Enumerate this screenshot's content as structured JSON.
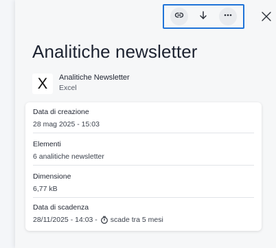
{
  "toolbar": {
    "link_icon": "link-icon",
    "download_icon": "arrow-down-icon",
    "more_icon": "more-horizontal-icon"
  },
  "close_icon": "close-icon",
  "title": "Analitiche newsletter",
  "file": {
    "icon_letter": "X",
    "name": "Analitiche Newsletter",
    "type": "Excel"
  },
  "details": {
    "created_label": "Data di creazione",
    "created_value": "28 mag 2025 - 15:03",
    "items_label": "Elementi",
    "items_value": "6 analitiche newsletter",
    "size_label": "Dimensione",
    "size_value": "6,77 kB",
    "expiry_label": "Data di scadenza",
    "expiry_value": "28/11/2025 - 14:03 -",
    "expiry_note": "scade tra 5 mesi"
  },
  "colors": {
    "accent": "#1f73d8",
    "panel": "#f6f7f8"
  }
}
